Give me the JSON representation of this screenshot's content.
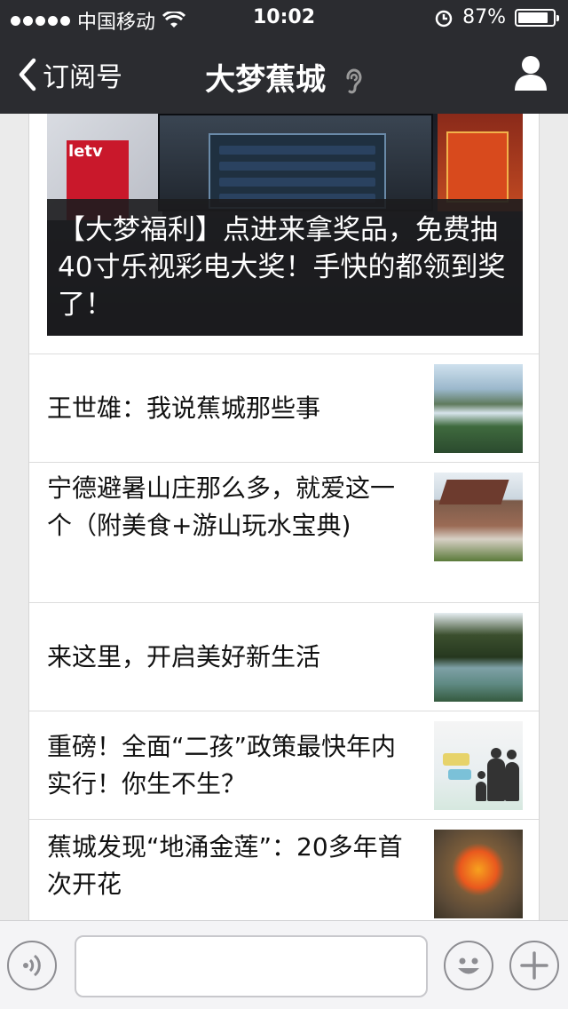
{
  "status_bar": {
    "carrier": "中国移动",
    "time": "10:02",
    "battery_text": "87%",
    "battery_level": 0.87,
    "icons": [
      "signal-dots-icon",
      "wifi-icon",
      "alarm-icon",
      "battery-icon"
    ]
  },
  "nav": {
    "back_label": "订阅号",
    "title": "大梦蕉城",
    "icons": [
      "chevron-left-icon",
      "ear-icon",
      "profile-icon"
    ]
  },
  "hero": {
    "caption": "【大梦福利】点进来拿奖品，免费抽40寸乐视彩电大奖！手快的都领到奖了！",
    "screen_logo": "letv"
  },
  "articles": [
    {
      "title": "王世雄：我说蕉城那些事",
      "thumb": "lake-mountain"
    },
    {
      "title": "宁德避暑山庄那么多，就爱这一个（附美食+游山玩水宝典)",
      "thumb": "wooden-house"
    },
    {
      "title": "来这里，开启美好新生活",
      "thumb": "pond-trees"
    },
    {
      "title": "重磅！全面“二孩”政策最快年内实行！你生不生？",
      "thumb": "family-silhouette"
    },
    {
      "title": "蕉城发现“地涌金莲”：20多年首次开花",
      "thumb": "golden-lotus"
    }
  ],
  "input_bar": {
    "placeholder": "",
    "icons": [
      "voice-icon",
      "emoji-icon",
      "plus-icon"
    ]
  },
  "colors": {
    "nav_bg": "#2b2c30",
    "page_bg": "#ebebeb",
    "card_bg": "#ffffff",
    "text": "#111111"
  }
}
